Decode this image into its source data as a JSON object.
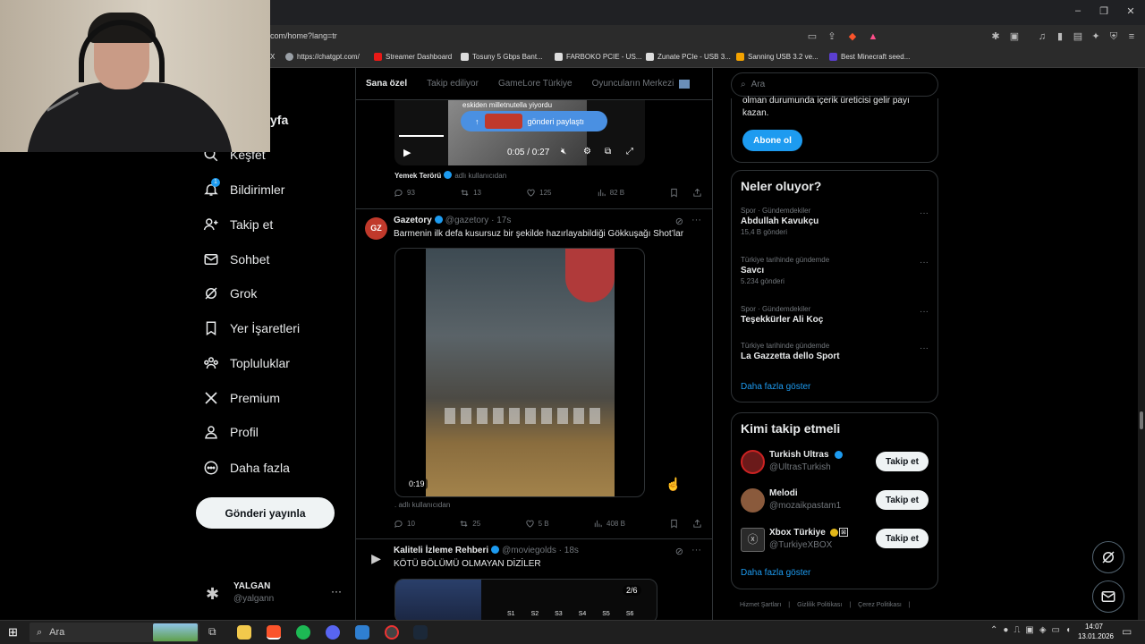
{
  "browser": {
    "url": "com/home?lang=tr",
    "bookmarks": [
      {
        "label": "X",
        "color": "#ffffff"
      },
      {
        "label": "https://chatgpt.com/",
        "color": "#9aa0a6"
      },
      {
        "label": "Streamer Dashboard",
        "color": "#e91916"
      },
      {
        "label": "Tosuny 5 Gbps Bant...",
        "color": "#dddddd"
      },
      {
        "label": "FARBOKO PCIE - US...",
        "color": "#dddddd"
      },
      {
        "label": "Zunate PCIe - USB 3...",
        "color": "#dddddd"
      },
      {
        "label": "Sanning USB 3.2 ve...",
        "color": "#f4a300"
      },
      {
        "label": "Best Minecraft seed...",
        "color": "#5b3fd0"
      }
    ]
  },
  "nav": {
    "partial_title": "yfa",
    "items": [
      {
        "label": "Keşfet",
        "icon": "search-icon"
      },
      {
        "label": "Bildirimler",
        "icon": "bell-icon",
        "badge": "1"
      },
      {
        "label": "Takip et",
        "icon": "person-add-icon"
      },
      {
        "label": "Sohbet",
        "icon": "mail-icon"
      },
      {
        "label": "Grok",
        "icon": "grok-icon"
      },
      {
        "label": "Yer İşaretleri",
        "icon": "bookmark-icon"
      },
      {
        "label": "Topluluklar",
        "icon": "communities-icon"
      },
      {
        "label": "Premium",
        "icon": "x-logo-icon"
      },
      {
        "label": "Profil",
        "icon": "profile-icon"
      },
      {
        "label": "Daha fazla",
        "icon": "more-circle-icon"
      }
    ],
    "post_button": "Gönderi yayınla",
    "account": {
      "name": "YALGAN",
      "handle": "@yalgann",
      "more": "···"
    }
  },
  "feed": {
    "tabs": [
      "Sana özel",
      "Takip ediliyor",
      "GameLore Türkiye",
      "Oyuncuların Merkezi"
    ],
    "top_tweet": {
      "caption_overlay": "eskiden milletnutella yiyordu",
      "share_label": "gönderi paylaştı",
      "time": "0:05 / 0:27",
      "source": "Yemek Terörü",
      "source_suffix": "adlı kullanıcıdan",
      "stats": {
        "replies": "93",
        "reposts": "13",
        "likes": "125",
        "views": "82 B"
      }
    },
    "tweet2": {
      "name": "Gazetory",
      "handle": "@gazetory",
      "time": "· 17s",
      "text": "Barmenin ilk defa kusursuz bir şekilde hazırlayabildiği Gökkuşağı Shot’lar",
      "video_duration": "0:19",
      "source_suffix": ". adlı kullanıcıdan",
      "stats": {
        "replies": "10",
        "reposts": "25",
        "likes": "5 B",
        "views": "408 B"
      }
    },
    "tweet3": {
      "name": "Kaliteli İzleme Rehberi",
      "handle": "@moviegolds",
      "time": "· 18s",
      "text": "KÖTÜ BÖLÜMÜ OLMAYAN DİZİLER",
      "page_indicator": "2/6",
      "season_labels": [
        "S1",
        "S2",
        "S3",
        "S4",
        "S5",
        "S6"
      ]
    }
  },
  "sidebar": {
    "search_placeholder": "Ara",
    "premium_text_partial": "olman durumunda içerik üreticisi gelir payı kazan.",
    "subscribe_button": "Abone ol",
    "trends_title": "Neler oluyor?",
    "trends": [
      {
        "category": "Spor · Gündemdekiler",
        "name": "Abdullah Kavukçu",
        "count": "15,4 B gönderi"
      },
      {
        "category": "Türkiye tarihinde gündemde",
        "name": "Savcı",
        "count": "5.234 gönderi"
      },
      {
        "category": "Spor · Gündemdekiler",
        "name": "Teşekkürler Ali Koç",
        "count": ""
      },
      {
        "category": "Türkiye tarihinde gündemde",
        "name": "La Gazzetta dello Sport",
        "count": ""
      }
    ],
    "show_more": "Daha fazla göster",
    "who_to_follow_title": "Kimi takip etmeli",
    "who_to_follow": [
      {
        "name": "Turkish Ultras",
        "handle": "@UltrasTurkish",
        "button": "Takip et",
        "badge": "blue"
      },
      {
        "name": "Melodi",
        "handle": "@mozaikpastam1",
        "button": "Takip et",
        "badge": ""
      },
      {
        "name": "Xbox Türkiye",
        "handle": "@TurkiyeXBOX",
        "button": "Takip et",
        "badge": "gold"
      }
    ],
    "show_more2": "Daha fazla göster",
    "footer_links": [
      "Hizmet Şartları",
      "Gizlilik Politikası",
      "Çerez Politikası"
    ]
  },
  "taskbar": {
    "search": "Ara",
    "time": "14:07",
    "date": "13.01.2026"
  }
}
